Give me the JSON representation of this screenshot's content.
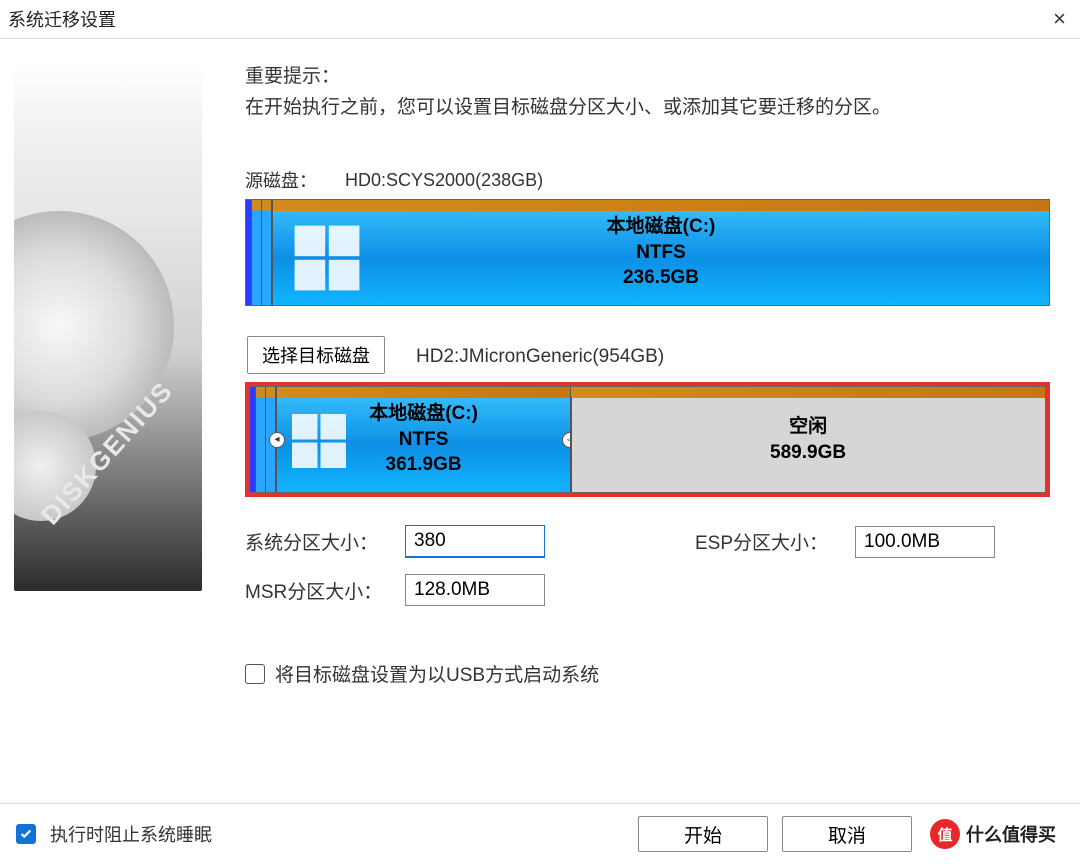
{
  "window": {
    "title": "系统迁移设置",
    "close_icon": "×"
  },
  "sidebar": {
    "brand": "DISKGENIUS"
  },
  "tip": {
    "title": "重要提示：",
    "text": "在开始执行之前，您可以设置目标磁盘分区大小、或添加其它要迁移的分区。"
  },
  "source": {
    "label": "源磁盘：",
    "disk_name": "HD0:SCYS2000(238GB)",
    "partition": {
      "name": "本地磁盘(C:)",
      "fs": "NTFS",
      "size": "236.5GB"
    }
  },
  "target": {
    "select_button": "选择目标磁盘",
    "disk_name": "HD2:JMicronGeneric(954GB)",
    "partition": {
      "name": "本地磁盘(C:)",
      "fs": "NTFS",
      "size": "361.9GB"
    },
    "free": {
      "label": "空闲",
      "size": "589.9GB"
    }
  },
  "inputs": {
    "sys_label": "系统分区大小：",
    "sys_value": "380",
    "esp_label": "ESP分区大小：",
    "esp_value": "100.0MB",
    "msr_label": "MSR分区大小：",
    "msr_value": "128.0MB"
  },
  "usb_checkbox": {
    "label": "将目标磁盘设置为以USB方式启动系统",
    "checked": false
  },
  "footer": {
    "sleep_checkbox": {
      "label": "执行时阻止系统睡眠",
      "checked": true
    },
    "start_button": "开始",
    "cancel_button": "取消",
    "watermark": {
      "badge": "值",
      "text": "什么值得买"
    }
  }
}
